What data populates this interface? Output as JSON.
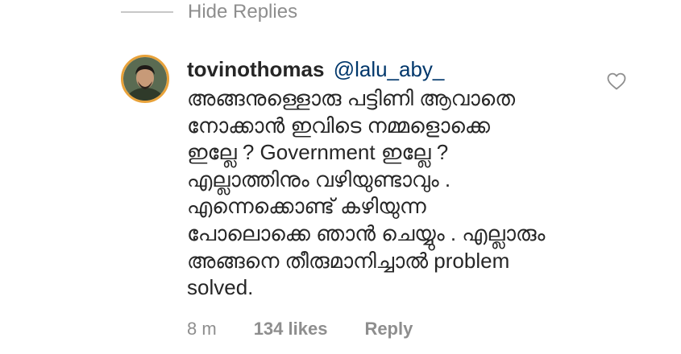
{
  "thread": {
    "hide_replies_label": "Hide Replies"
  },
  "comment": {
    "username": "tovinothomas",
    "mention": "@lalu_aby_",
    "body_lines": [
      "അങ്ങനുള്ളൊരു പട്ടിണി ആവാതെ",
      "നോക്കാൻ ഇവിടെ നമ്മളൊക്കെ",
      "ഇല്ലേ ? Government ഇല്ലേ ?",
      "എല്ലാത്തിനും വഴിയുണ്ടാവും .",
      "എന്നെക്കൊണ്ട് കഴിയുന്ന",
      "പോലൊക്കെ ഞാൻ ചെയ്യും . എല്ലാരും",
      "അങ്ങനെ തീരുമാനിച്ചാൽ problem",
      "solved."
    ],
    "time": "8 m",
    "likes": "134 likes",
    "reply_label": "Reply",
    "avatar_icon": "profile-photo",
    "like_icon": "heart-outline-icon"
  },
  "colors": {
    "text": "#262626",
    "secondary": "#8e8e8e",
    "mention": "#00376b",
    "avatar_ring": "#e8a23a"
  }
}
